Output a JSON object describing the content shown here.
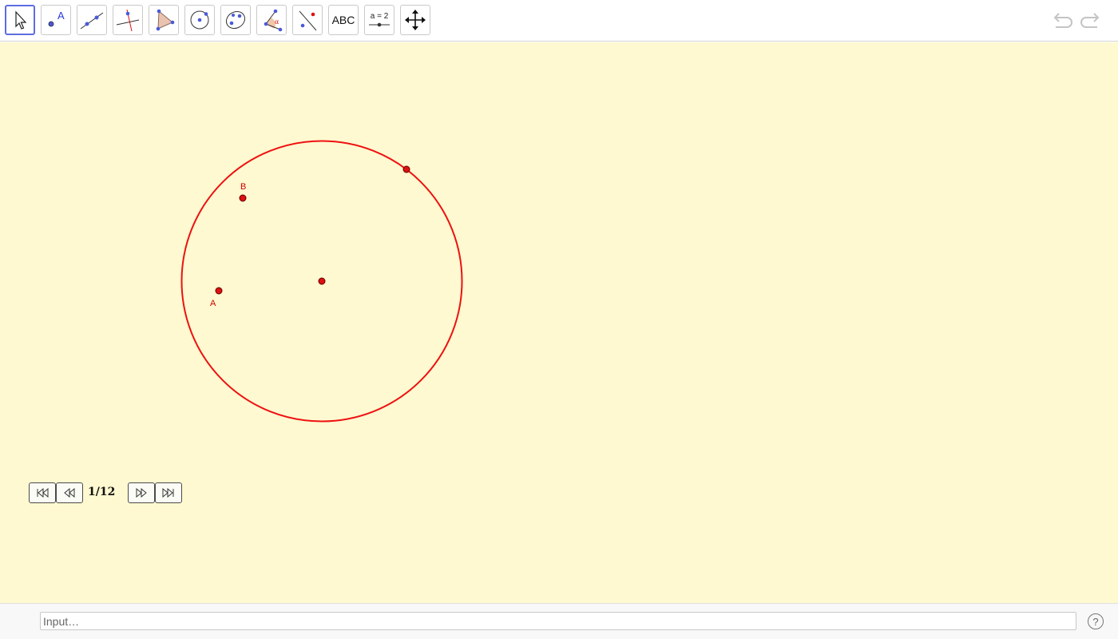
{
  "toolbar": {
    "tools": [
      {
        "icon": "move-arrow-icon"
      },
      {
        "icon": "point-icon",
        "text": "A"
      },
      {
        "icon": "line-icon"
      },
      {
        "icon": "perpendicular-line-icon"
      },
      {
        "icon": "polygon-icon"
      },
      {
        "icon": "circle-center-point-icon"
      },
      {
        "icon": "ellipse-icon"
      },
      {
        "icon": "angle-icon",
        "text": "α"
      },
      {
        "icon": "reflect-icon"
      },
      {
        "icon": "text-icon",
        "text": "ABC"
      },
      {
        "icon": "slider-icon",
        "text": "a = 2"
      },
      {
        "icon": "move-graphics-view-icon"
      }
    ],
    "selected_tool": "move-arrow-icon",
    "undo_icon": "undo-icon",
    "redo_icon": "redo-icon"
  },
  "graphics": {
    "background": "#fef9d0",
    "object_color": "#ee1111",
    "point_fill": "#dd1111",
    "labels": {
      "point_a": "A",
      "point_b": "B"
    }
  },
  "navigation": {
    "step_counter": "1/12",
    "first_icon": "first-step-icon",
    "previous_icon": "previous-step-icon",
    "next_icon": "next-step-icon",
    "last_icon": "last-step-icon"
  },
  "input_bar": {
    "placeholder": "Input…",
    "value": "",
    "help_label": "?"
  }
}
